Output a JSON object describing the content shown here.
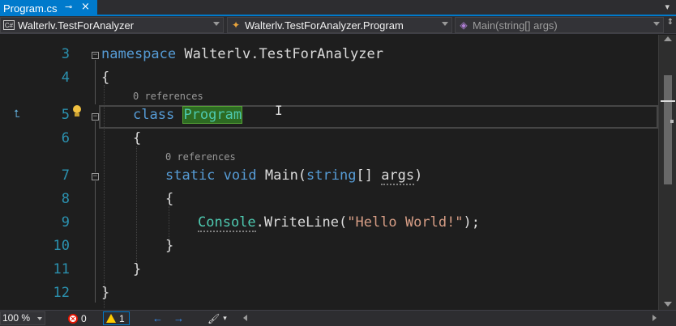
{
  "tab": {
    "title": "Program.cs",
    "pin_icon": "⊸",
    "close_icon": "×"
  },
  "navbar": {
    "project": "Walterlv.TestForAnalyzer",
    "type": "Walterlv.TestForAnalyzer.Program",
    "member": "Main(string[] args)"
  },
  "lines": [
    {
      "num": "3",
      "tokens": [
        {
          "t": "namespace",
          "c": "kw"
        },
        {
          "t": " Walterlv.TestForAnalyzer",
          "c": ""
        }
      ]
    },
    {
      "num": "4",
      "tokens": [
        {
          "t": "{",
          "c": ""
        }
      ]
    },
    {
      "num": "5",
      "codelens": "0 references",
      "tokens": [
        {
          "t": "class",
          "c": "kw"
        },
        {
          "t": " ",
          "c": ""
        },
        {
          "t": "Program",
          "c": "hl"
        }
      ]
    },
    {
      "num": "6",
      "tokens": [
        {
          "t": "{",
          "c": ""
        }
      ]
    },
    {
      "num": "7",
      "codelens": "0 references",
      "tokens": [
        {
          "t": "static",
          "c": "kw"
        },
        {
          "t": " ",
          "c": ""
        },
        {
          "t": "void",
          "c": "kw"
        },
        {
          "t": " Main(",
          "c": ""
        },
        {
          "t": "string",
          "c": "kw"
        },
        {
          "t": "[] ",
          "c": ""
        },
        {
          "t": "args",
          "c": "dots"
        },
        {
          "t": ")",
          "c": ""
        }
      ]
    },
    {
      "num": "8",
      "tokens": [
        {
          "t": "{",
          "c": ""
        }
      ]
    },
    {
      "num": "9",
      "tokens": [
        {
          "t": "Console",
          "c": "type dots"
        },
        {
          "t": ".WriteLine(",
          "c": ""
        },
        {
          "t": "\"Hello World!\"",
          "c": "str"
        },
        {
          "t": ");",
          "c": ""
        }
      ]
    },
    {
      "num": "10",
      "tokens": [
        {
          "t": "}",
          "c": ""
        }
      ]
    },
    {
      "num": "11",
      "tokens": [
        {
          "t": "}",
          "c": ""
        }
      ]
    },
    {
      "num": "12",
      "tokens": [
        {
          "t": "}",
          "c": ""
        }
      ]
    }
  ],
  "status": {
    "zoom": "100 %",
    "errors": "0",
    "warnings": "1"
  },
  "colors": {
    "accent": "#007acc",
    "keyword": "#569cd6",
    "type": "#4ec9b0",
    "string": "#d69d85",
    "line_number": "#2b91af"
  }
}
